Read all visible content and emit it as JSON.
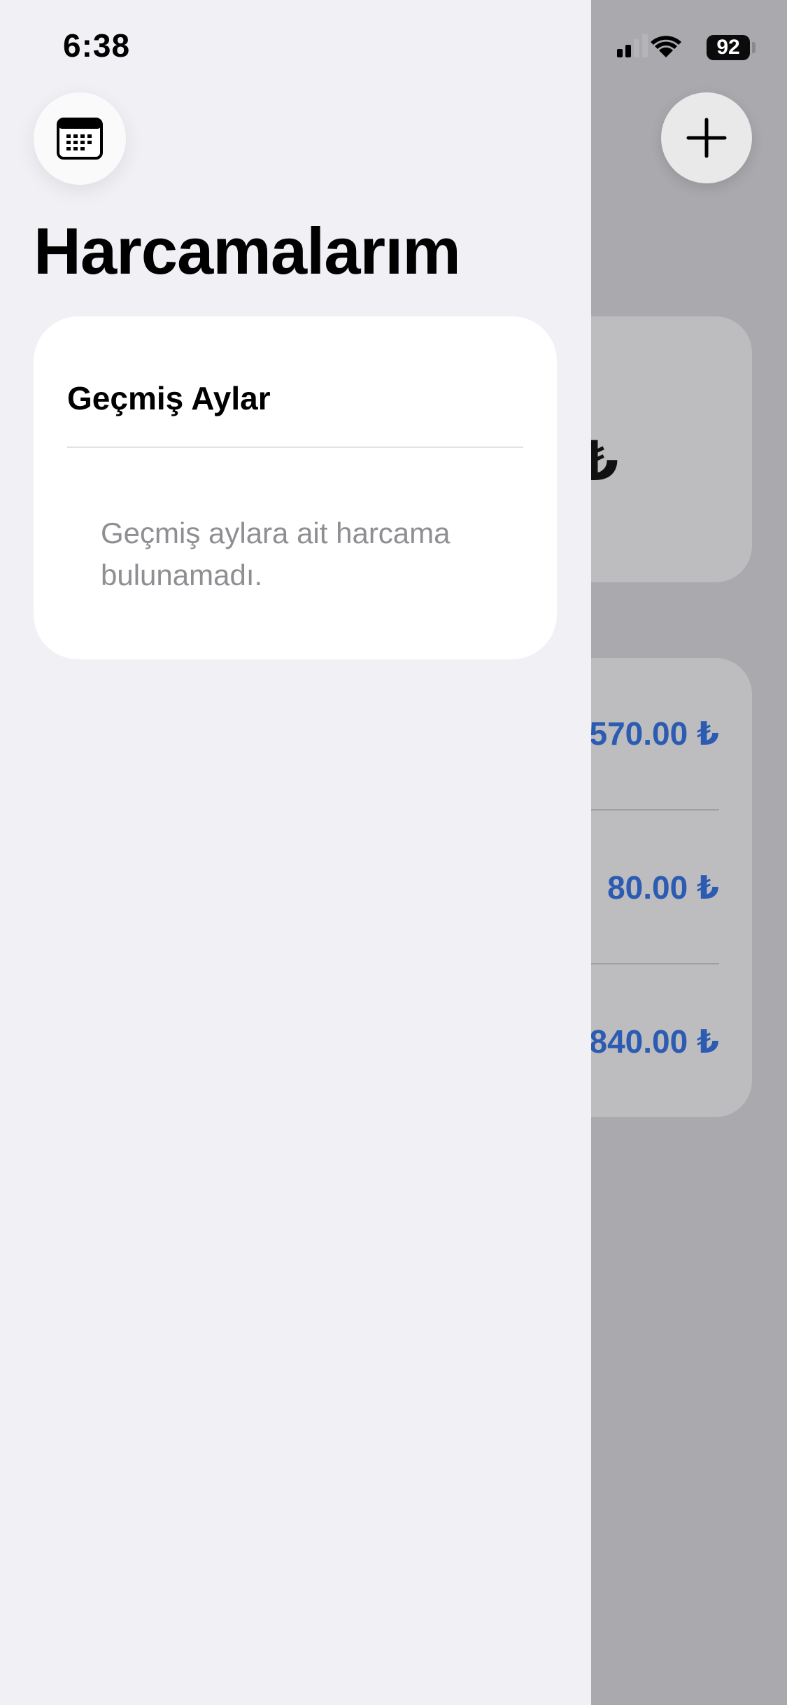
{
  "status_bar": {
    "time": "6:38",
    "battery": "92"
  },
  "drawer": {
    "title": "Harcamalarım",
    "calendar_icon": "calendar-icon",
    "past_months": {
      "title": "Geçmiş Aylar",
      "empty_message": "Geçmiş aylara ait harcama bulunamadı."
    }
  },
  "background": {
    "add_icon": "plus-icon",
    "total_symbol": "₺",
    "amounts": [
      "570.00 ₺",
      "80.00 ₺",
      "840.00 ₺"
    ],
    "accent_color": "#2c5bb2"
  }
}
